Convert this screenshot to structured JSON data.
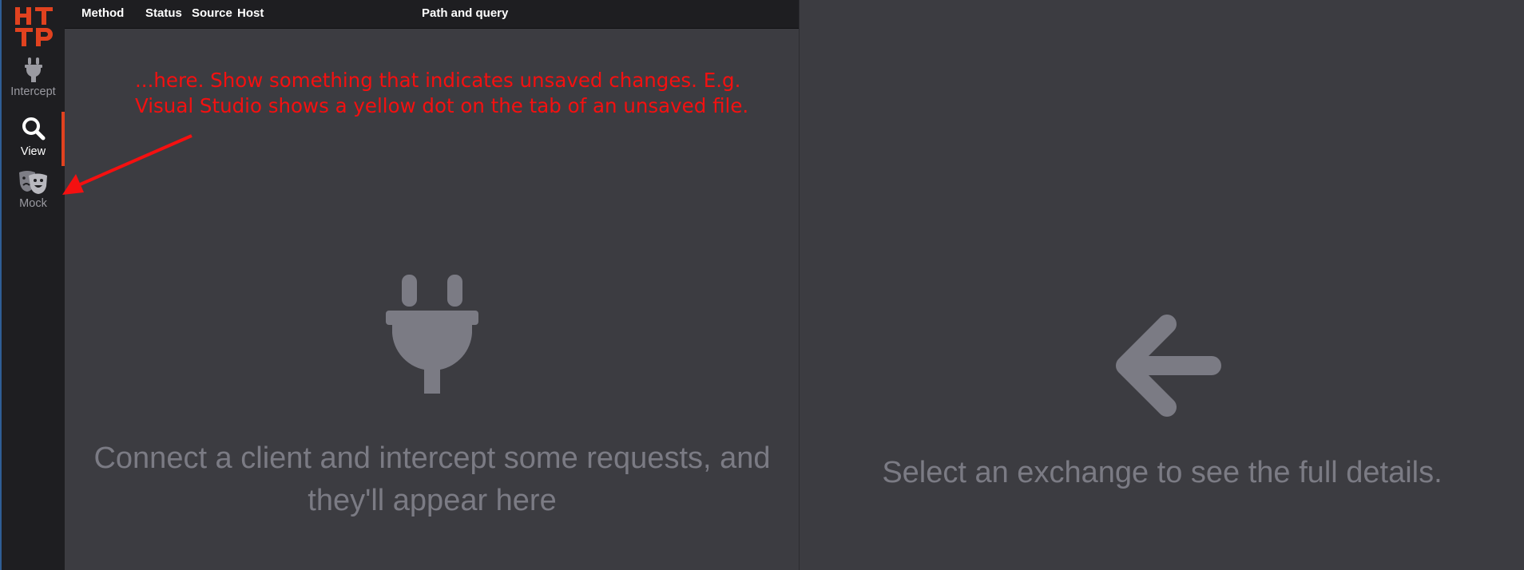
{
  "app": {
    "logo_text": "HTTP"
  },
  "sidebar": {
    "items": [
      {
        "label": "Intercept",
        "icon": "plug-icon",
        "selected": false
      },
      {
        "label": "View",
        "icon": "search-icon",
        "selected": true
      },
      {
        "label": "Mock",
        "icon": "theater-masks-icon",
        "selected": false
      }
    ]
  },
  "table": {
    "columns": [
      "Method",
      "Status",
      "Source",
      "Host",
      "Path and query"
    ]
  },
  "list": {
    "empty_icon": "plug-icon",
    "empty_message": "Connect a client and intercept some requests, and they'll appear here"
  },
  "detail": {
    "empty_icon": "arrow-left-icon",
    "empty_message": "Select an exchange to see the full details."
  },
  "annotation": {
    "line1": "...here. Show something that indicates unsaved changes. E.g.",
    "line2": "Visual Studio shows a yellow dot on the tab of an unsaved file.",
    "color": "#f51010"
  },
  "colors": {
    "accent": "#e1421f",
    "sidebar_bg": "#1e1e21",
    "main_bg": "#3c3c41",
    "muted": "#7b7b84"
  }
}
